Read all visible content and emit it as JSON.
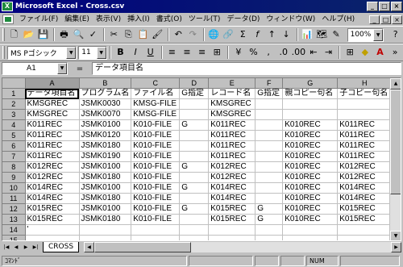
{
  "window": {
    "title": "Microsoft Excel - Cross.csv",
    "min_symbol": "_",
    "max_symbol": "□",
    "close_symbol": "×",
    "doc_min_symbol": "_",
    "doc_max_symbol": "□",
    "doc_close_symbol": "×"
  },
  "menu": [
    "ファイル(F)",
    "編集(E)",
    "表示(V)",
    "挿入(I)",
    "書式(O)",
    "ツール(T)",
    "データ(D)",
    "ウィンドウ(W)",
    "ヘルプ(H)"
  ],
  "toolbar": {
    "zoom": "100%"
  },
  "format_toolbar": {
    "font": "MS Pゴシック",
    "size": "11",
    "bold": "B",
    "italic": "I",
    "underline": "U"
  },
  "formula_bar": {
    "cell_ref": "A1",
    "eq": "=",
    "content": "データ項目名"
  },
  "grid": {
    "columns": [
      "A",
      "B",
      "C",
      "D",
      "E",
      "F",
      "G",
      "H"
    ],
    "rows": [
      [
        "データ項目名",
        "プログラム名",
        "ファイル名",
        "G指定",
        "レコード名",
        "G指定",
        "親コピー句名",
        "子コピー句名"
      ],
      [
        "KMSGREC",
        "JSMK0030",
        "KMSG-FILE",
        "",
        "KMSGREC",
        "",
        "",
        ""
      ],
      [
        "KMSGREC",
        "JSMK0070",
        "KMSG-FILE",
        "",
        "KMSGREC",
        "",
        "",
        ""
      ],
      [
        "K011REC",
        "JSMK0100",
        "K010-FILE",
        "G",
        "K011REC",
        "",
        "K010REC",
        "K011REC"
      ],
      [
        "K011REC",
        "JSMK0120",
        "K010-FILE",
        "",
        "K011REC",
        "",
        "K010REC",
        "K011REC"
      ],
      [
        "K011REC",
        "JSMK0180",
        "K010-FILE",
        "",
        "K011REC",
        "",
        "K010REC",
        "K011REC"
      ],
      [
        "K011REC",
        "JSMK0190",
        "K010-FILE",
        "",
        "K011REC",
        "",
        "K010REC",
        "K011REC"
      ],
      [
        "K012REC",
        "JSMK0100",
        "K010-FILE",
        "G",
        "K012REC",
        "",
        "K010REC",
        "K012REC"
      ],
      [
        "K012REC",
        "JSMK0180",
        "K010-FILE",
        "",
        "K012REC",
        "",
        "K010REC",
        "K012REC"
      ],
      [
        "K014REC",
        "JSMK0100",
        "K010-FILE",
        "G",
        "K014REC",
        "",
        "K010REC",
        "K014REC"
      ],
      [
        "K014REC",
        "JSMK0180",
        "K010-FILE",
        "",
        "K014REC",
        "",
        "K010REC",
        "K014REC"
      ],
      [
        "K015REC",
        "JSMK0100",
        "K010-FILE",
        "G",
        "K015REC",
        "G",
        "K010REC",
        "K015REC"
      ],
      [
        "K015REC",
        "JSMK0180",
        "K010-FILE",
        "",
        "K015REC",
        "G",
        "K010REC",
        "K015REC"
      ],
      [
        "'",
        "",
        "",
        "",
        "",
        "",
        "",
        ""
      ],
      [
        "",
        "",
        "",
        "",
        "",
        "",
        "",
        ""
      ],
      [
        "",
        "",
        "",
        "",
        "",
        "",
        "",
        ""
      ]
    ]
  },
  "sheet_tabs": [
    "CROSS"
  ],
  "status": {
    "mode": "ｺﾏﾝﾄﾞ",
    "num": "NUM"
  }
}
